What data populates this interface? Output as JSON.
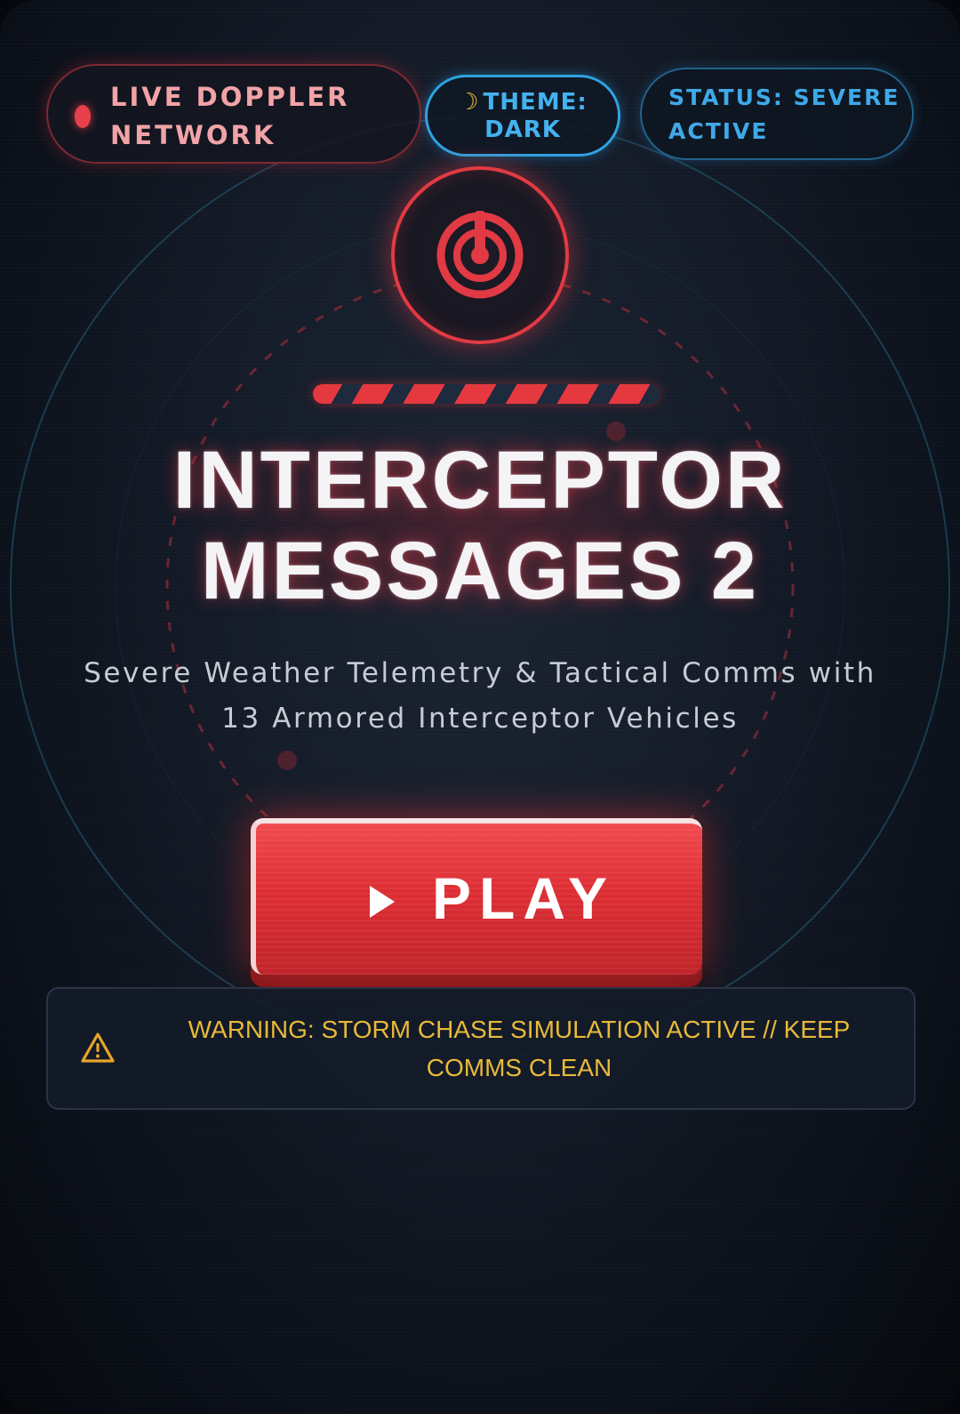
{
  "header": {
    "live_network": "LIVE DOPPLER NETWORK",
    "theme_icon": "moon-icon",
    "theme_line1": "THEME:",
    "theme_line2": "DARK",
    "status": "STATUS: SEVERE ACTIVE"
  },
  "emblem": {
    "icon": "radar-target-icon"
  },
  "title": {
    "line1": "INTERCEPTOR",
    "line2": "MESSAGES 2"
  },
  "subtitle": "Severe Weather Telemetry & Tactical Comms with 13 Armored Interceptor Vehicles",
  "play_button": {
    "icon": "play-icon",
    "label": "PLAY"
  },
  "warning": {
    "icon": "warning-triangle-icon",
    "text": "WARNING: STORM CHASE SIMULATION ACTIVE // KEEP COMMS CLEAN"
  },
  "colors": {
    "accent_red": "#e23a44",
    "accent_blue": "#2ea3e0",
    "warning_amber": "#e8b93a",
    "background": "#141b28"
  }
}
